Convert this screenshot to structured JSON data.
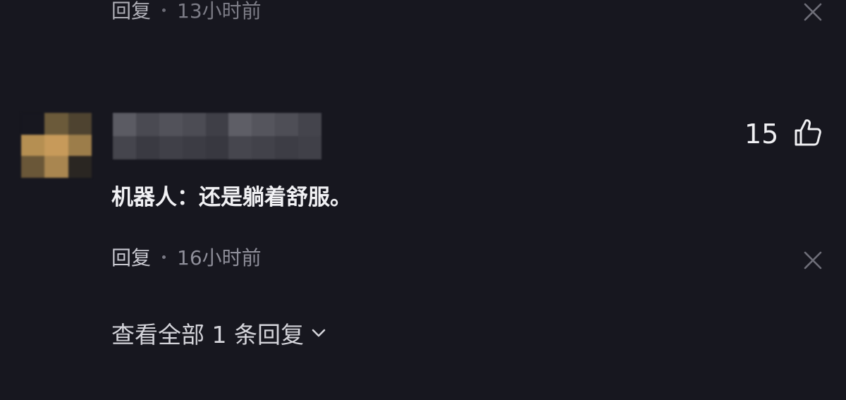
{
  "previous_comment": {
    "reply_label": "回复",
    "time": "13小时前"
  },
  "comment": {
    "text": "机器人：还是躺着舒服。",
    "likes": "15",
    "reply_label": "回复",
    "time": "16小时前",
    "username_redacted": true,
    "avatar_redacted": true
  },
  "view_replies": {
    "label": "查看全部 1 条回复"
  },
  "icons": {
    "close": "close-icon",
    "like": "thumbs-up-icon",
    "expand": "chevron-down-icon"
  },
  "colors": {
    "background": "#17171f",
    "primary_text": "#f1f1f4",
    "secondary_text": "#8e8e99"
  }
}
